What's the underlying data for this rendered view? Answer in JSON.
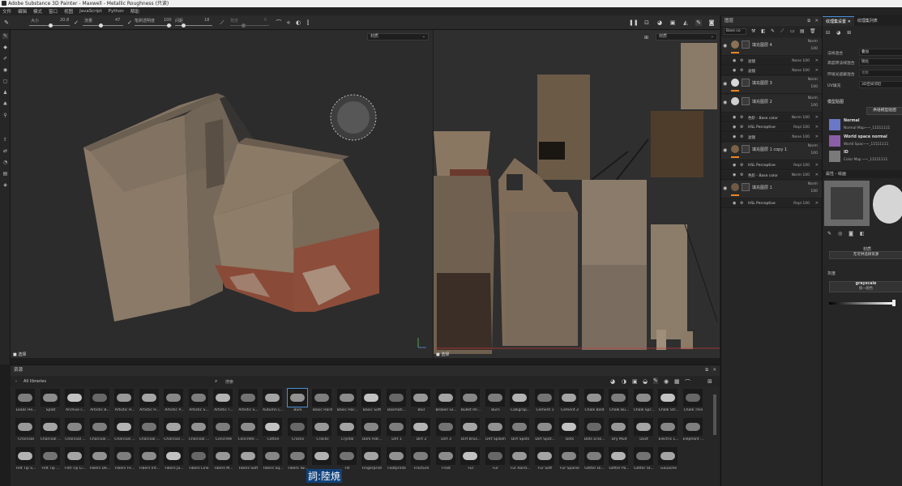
{
  "window": {
    "title": "Adobe Substance 3D Painter - Maxwell - Metallic Roughness (只读)"
  },
  "menu": [
    "文件",
    "编辑",
    "模式",
    "窗口",
    "视图",
    "JavaScript",
    "Python",
    "帮助"
  ],
  "toolbar": {
    "size_label": "大小",
    "size_value": "20.8",
    "flow_label": "流量",
    "flow_value": "47",
    "stroke_opacity_label": "笔刷透明度",
    "stroke_opacity_value": "100",
    "spacing_label": "间距",
    "spacing_value": "18",
    "angle_label": "角度",
    "angle_value": "0"
  },
  "viewport3d": {
    "mode_dropdown": "材质",
    "status_label": "选择"
  },
  "viewport2d": {
    "mode_dropdown": "材质",
    "status_label": "选择"
  },
  "assets": {
    "title": "资源",
    "library_label": "All libraries",
    "search_placeholder": "搜索",
    "overlay_text": "詞:陸焼",
    "brushes": [
      "Leaks He...",
      "Splat",
      "Archive I...",
      "Artistic B...",
      "Artistic H...",
      "Artistic H...",
      "Artistic P...",
      "Artistic S...",
      "Artistic T...",
      "Artistic S...",
      "Autumn L...",
      "Bark",
      "Basic Hard",
      "Basic Har...",
      "Basic Soft",
      "Basmati...",
      "Blur",
      "Broken Gl...",
      "Bullet Im...",
      "Burn",
      "Calligrap...",
      "Cement 1",
      "Cement 2",
      "Chalk Bold",
      "Chalk Bu...",
      "Chalk Spr...",
      "Chalk Str...",
      "Chalk Thin",
      "Charcoal",
      "Charcoal ...",
      "Charcoal ...",
      "Charcoal ...",
      "Charcoal ...",
      "Charcoal ...",
      "Charcoal ...",
      "Charcoal ...",
      "Concrete",
      "Concrete ...",
      "Cotton",
      "Cracks",
      "Cracks",
      "Crystal",
      "Dark Hat...",
      "Dirt 1",
      "Dirt 2",
      "Dirt 3",
      "Dirt Brus...",
      "Dirt Splash",
      "Dirt Spots",
      "Dirt Spot...",
      "Dots",
      "Dots Eras...",
      "Dry Mud",
      "Dust",
      "Electric L...",
      "Elephant ...",
      "Felt Tip S...",
      "Felt Tip ...",
      "Felt Tip Li...",
      "Fibers De...",
      "Fibers Fe...",
      "Fibers Int...",
      "Fibers Ja...",
      "Fibers Line",
      "Fibers M...",
      "Fibers Soft",
      "Fibers Sq...",
      "Fibers Tw...",
      "",
      "Fill",
      "Fingerprint",
      "Footprints",
      "Fracture",
      "Frost",
      "Fur",
      "Fur",
      "Fur Rand...",
      "Fur Soft",
      "Fur Sparse",
      "Glitter Di...",
      "Glitter Pa...",
      "Glitter St...",
      "Gouache"
    ]
  },
  "layers": {
    "title": "图层",
    "channel": "Base co",
    "items": [
      {
        "name": "填充图层 4",
        "blend": "Norm",
        "opacity": "100",
        "thumb": "#8a7156",
        "bar": true
      },
      {
        "name": "滤镜",
        "blend": "None",
        "opacity": "100",
        "sub": true
      },
      {
        "name": "滤镜",
        "blend": "None",
        "opacity": "100",
        "sub": true
      },
      {
        "name": "填充图层 3",
        "blend": "Norm",
        "opacity": "100",
        "thumb": "#d8d8d8",
        "bar": true
      },
      {
        "name": "填充图层 2",
        "blend": "Norm",
        "opacity": "100",
        "thumb": "#d0d0d0",
        "bar": false
      },
      {
        "name": "色阶 - Base color",
        "blend": "Norm",
        "opacity": "100",
        "sub": true
      },
      {
        "name": "HSL Perceptive",
        "blend": "Repl",
        "opacity": "100",
        "sub": true
      },
      {
        "name": "滤镜",
        "blend": "None",
        "opacity": "100",
        "sub": true
      },
      {
        "name": "填充图层 1 copy 1",
        "blend": "Norm",
        "opacity": "100",
        "thumb": "#7a6148",
        "bar": true
      },
      {
        "name": "HSL Perceptive",
        "blend": "Repl",
        "opacity": "100",
        "sub": true
      },
      {
        "name": "色阶 - Base color",
        "blend": "Norm",
        "opacity": "100",
        "sub": true
      },
      {
        "name": "填充图层 1",
        "blend": "Norm",
        "opacity": "100",
        "thumb": "#6e5a44",
        "bar": true
      },
      {
        "name": "HSL Perceptive",
        "blend": "Repl",
        "opacity": "100",
        "sub": true
      }
    ]
  },
  "texset": {
    "tab_active": "纹理集设置",
    "tab_other": "纹理集列表",
    "rows": [
      {
        "label": "法线混合",
        "value": "叠加"
      },
      {
        "label": "高度转法线混合",
        "value": "锐化"
      },
      {
        "label": "环境光遮蔽混合",
        "value": "相乘"
      },
      {
        "label": "UV填充",
        "value": "3D空间邻近"
      }
    ],
    "model_maps_title": "模型贴图",
    "bake_button": "烘焙模型贴图",
    "maps": [
      {
        "title": "Normal",
        "sub": "Normal Map~~_11511111"
      },
      {
        "title": "World space normal",
        "sub": "World Spac~~_11511111"
      },
      {
        "title": "ID",
        "sub": "Color Map ~~_11511111"
      }
    ],
    "properties_title": "属性 - 绘画",
    "material_label": "材质",
    "material_sub": "无可供选择资源",
    "height_label": "灰度",
    "grayscale_label": "grayscale",
    "grayscale_sub": "统一颜色"
  }
}
